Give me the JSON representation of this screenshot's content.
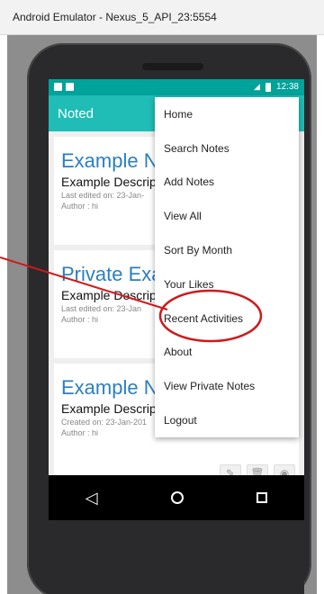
{
  "window": {
    "title": "Android Emulator - Nexus_5_API_23:5554"
  },
  "status_bar": {
    "time": "12:38"
  },
  "app_bar": {
    "title": "Noted"
  },
  "notes": [
    {
      "title": "Example No",
      "description": "Example Descrip",
      "meta": "Last edited on: 23-Jan-",
      "author": "Author : hi"
    },
    {
      "title": "Private Exa",
      "description": "Example Descrip",
      "meta": "Last edited on: 23-Jan",
      "author": "Author : hi"
    },
    {
      "title": "Example No",
      "description": "Example Descrip",
      "meta": "Created on: 23-Jan-201",
      "author": "Author : hi"
    }
  ],
  "note_actions": [
    "edit-icon",
    "delete-icon",
    "view-icon"
  ],
  "menu": {
    "items": [
      {
        "label": "Home"
      },
      {
        "label": "Search Notes"
      },
      {
        "label": "Add Notes"
      },
      {
        "label": "View All"
      },
      {
        "label": "Sort By Month"
      },
      {
        "label": "Your Likes"
      },
      {
        "label": "Recent Activities"
      },
      {
        "label": "About"
      },
      {
        "label": "View Private Notes"
      },
      {
        "label": "Logout"
      }
    ],
    "highlighted": "Recent Activities"
  },
  "colors": {
    "accent": "#1fbdb5",
    "status_bar": "#00a39a",
    "title_blue": "#2b7fc0",
    "annotation_red": "#d0191b"
  }
}
